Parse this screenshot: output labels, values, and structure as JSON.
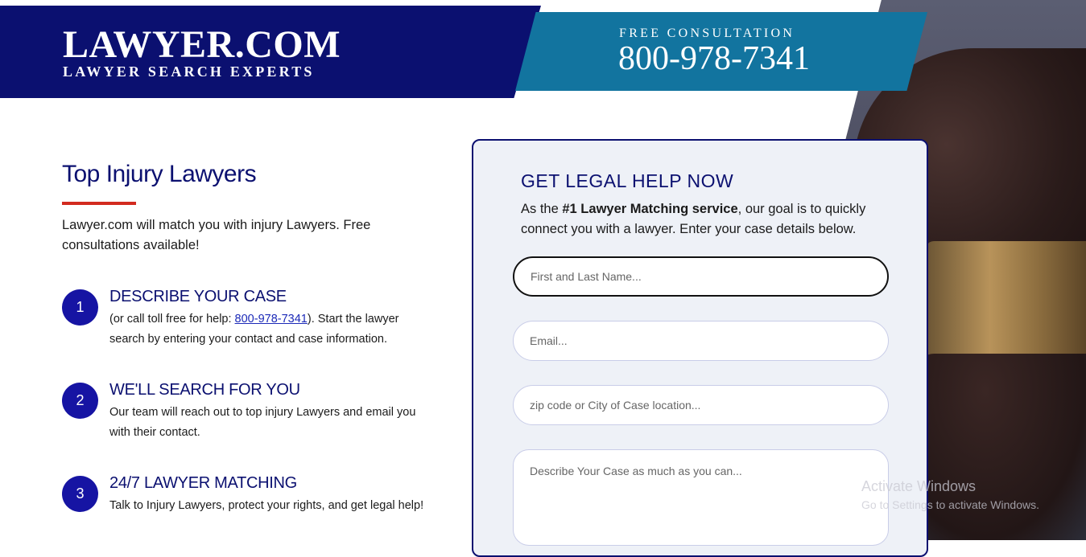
{
  "header": {
    "brand_name": "LAWYER.COM",
    "brand_tagline": "LAWYER SEARCH EXPERTS",
    "consult_label": "FREE CONSULTATION",
    "consult_phone": "800-978-7341"
  },
  "main": {
    "title": "Top Injury Lawyers",
    "intro": "Lawyer.com will match you with injury Lawyers. Free consultations available!",
    "steps": [
      {
        "number": "1",
        "title": "DESCRIBE YOUR CASE",
        "desc_prefix": "(or call toll free for help: ",
        "desc_link": "800-978-7341",
        "desc_suffix": "). Start the lawyer search by entering your contact and case information."
      },
      {
        "number": "2",
        "title": "WE'LL SEARCH FOR YOU",
        "desc": "Our team will reach out to top injury Lawyers and email you with their contact."
      },
      {
        "number": "3",
        "title": "24/7 LAWYER MATCHING",
        "desc": "Talk to Injury Lawyers, protect your rights, and get legal help!"
      }
    ]
  },
  "form": {
    "heading": "GET LEGAL HELP NOW",
    "intro_prefix": "As the ",
    "intro_bold": "#1 Lawyer Matching service",
    "intro_suffix": ", our goal is to quickly connect you with a lawyer. Enter your case details below.",
    "name_placeholder": "First and Last Name...",
    "email_placeholder": "Email...",
    "zip_placeholder": "zip code or City of Case location...",
    "case_placeholder": "Describe Your Case as much as you can..."
  },
  "watermark": {
    "title": "Activate Windows",
    "subtitle": "Go to Settings to activate Windows."
  },
  "colors": {
    "navy": "#0b1070",
    "teal": "#12749f",
    "accent_red": "#d22a1f",
    "step_circle": "#1614a3"
  }
}
